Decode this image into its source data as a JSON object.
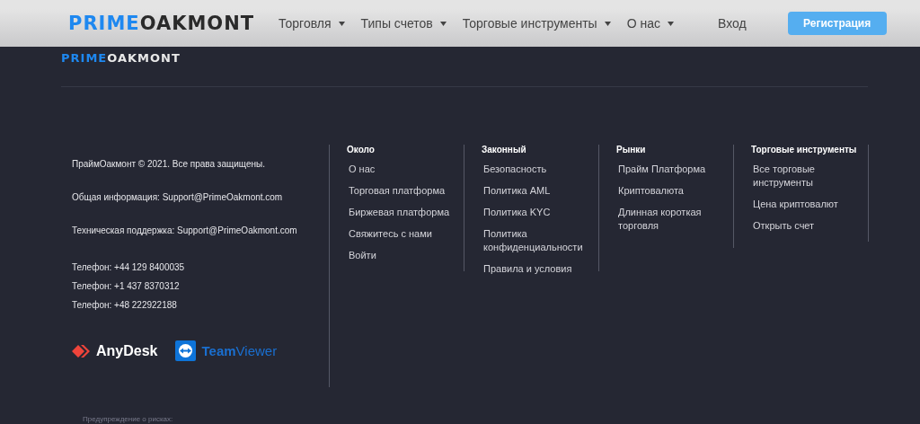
{
  "header": {
    "logo": {
      "part_1": "PRIME",
      "part_2": "OAKMONT"
    },
    "nav": [
      {
        "label": "Торговля",
        "dropdown": true
      },
      {
        "label": "Типы счетов",
        "dropdown": true
      },
      {
        "label": "Торговые инструменты",
        "dropdown": true
      },
      {
        "label": "О нас",
        "dropdown": true
      }
    ],
    "login": "Вход",
    "register": "Регистрация"
  },
  "footer": {
    "logo": {
      "part_1": "PRIME",
      "part_2": "OAKMONT"
    },
    "info": [
      "ПраймОакмонт © 2021. Все права защищены.",
      "Общая информация: Support@PrimeOakmont.com",
      "Техническая поддержка: Support@PrimeOakmont.com"
    ],
    "phones": [
      "Телефон: +44 129 8400035",
      "Телефон: +1 437 8370312",
      "Телефон: +48 222922188"
    ],
    "partners": [
      {
        "kind": "anydesk",
        "name": "AnyDesk"
      },
      {
        "kind": "teamviewer",
        "name_1": "Team",
        "name_2": "Viewer"
      }
    ],
    "columns": [
      {
        "title": "Около",
        "links": [
          "О нас",
          "Торговая платформа",
          "Биржевая платформа",
          "Свяжитесь с нами",
          "Войти"
        ]
      },
      {
        "title": "Законный",
        "links": [
          "Безопасность",
          "Политика AML",
          "Политика KYC",
          "Политика конфиденциальности",
          "Правила и условия"
        ]
      },
      {
        "title": "Рынки",
        "links": [
          "Прайм Платформа",
          "Криптовалюта",
          "Длинная короткая торговля"
        ]
      },
      {
        "title": "Торговые инструменты",
        "links": [
          "Все торговые инструменты",
          "Цена криптовалют",
          "Открыть счет"
        ]
      }
    ],
    "risk_warning": "Предупреждение о рисках:"
  }
}
